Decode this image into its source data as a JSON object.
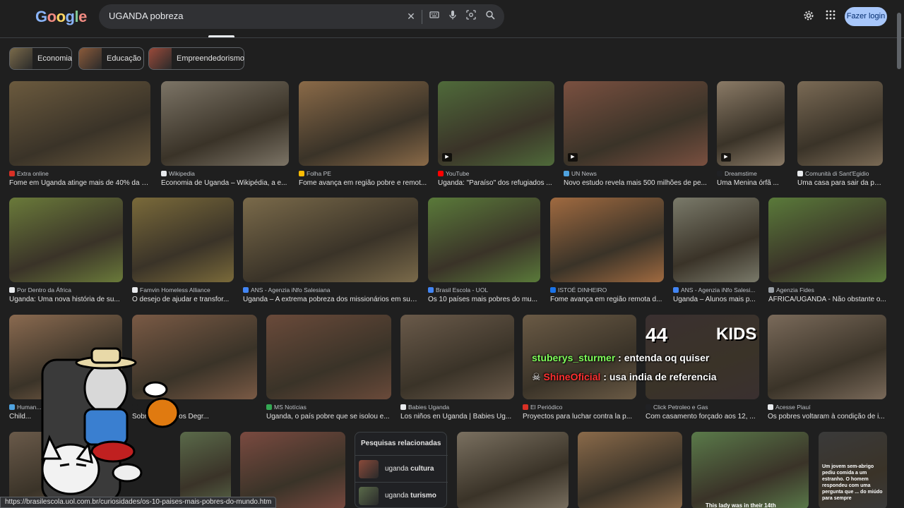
{
  "header": {
    "logo": [
      "G",
      "o",
      "o",
      "g",
      "l",
      "e"
    ],
    "logo_colors": [
      "#8ab4f8",
      "#f28b82",
      "#fdd663",
      "#8ab4f8",
      "#81c995",
      "#f28b82"
    ],
    "search_query": "UGANDA pobreza",
    "login_label": "Fazer login",
    "icons": [
      "clear-icon",
      "keyboard-icon",
      "mic-icon",
      "lens-icon",
      "search-icon",
      "settings-icon",
      "apps-icon"
    ]
  },
  "chips": [
    {
      "label": "Economia",
      "color": "#7a6a4a"
    },
    {
      "label": "Educação",
      "color": "#8a5a3a"
    },
    {
      "label": "Empreendedorismo",
      "color": "#9a4a3a"
    }
  ],
  "row1": [
    {
      "source": "Extra online",
      "caption": "Fome em Uganda atinge mais de 40% da p...",
      "fav": "#d93025",
      "color": "#6b5a3e"
    },
    {
      "source": "Wikipedia",
      "caption": "Economia de Uganda – Wikipédia, a e...",
      "fav": "#e8eaed",
      "color": "#7c7466"
    },
    {
      "source": "Folha PE",
      "caption": "Fome avança em região pobre e remot...",
      "fav": "#fbbc04",
      "color": "#8a6a48"
    },
    {
      "source": "YouTube",
      "caption": "Uganda: \"Paraíso\" dos refugiados ...",
      "fav": "#ff0000",
      "color": "#4f6a3a",
      "video": true
    },
    {
      "source": "UN News",
      "caption": "Novo estudo revela mais 500 milhões de pe...",
      "fav": "#4fa3e0",
      "color": "#7a5040",
      "video": true
    },
    {
      "source": "Dreamstime",
      "caption": "Uma Menina órfã ...",
      "fav": "#202124",
      "color": "#8a7a66",
      "video": true
    },
    {
      "source": "Comunità di Sant'Egidio",
      "caption": "Uma casa para sair da pob...",
      "fav": "#e8eaed",
      "color": "#7a6a55"
    }
  ],
  "row2": [
    {
      "source": "Por Dentro da África",
      "caption": "Uganda: Uma nova história de su...",
      "fav": "#e8eaed",
      "color": "#6a7a3a"
    },
    {
      "source": "Famvin Homeless Alliance",
      "caption": "O desejo de ajudar e transfor...",
      "fav": "#e8eaed",
      "color": "#7a6a3a"
    },
    {
      "source": "ANS - Agenzia iNfo Salesiana",
      "caption": "Uganda – A extrema pobreza dos missionários em sua...",
      "fav": "#4285f4",
      "color": "#7a6a4a"
    },
    {
      "source": "Brasil Escola - UOL",
      "caption": "Os 10 países mais pobres do mu...",
      "fav": "#4285f4",
      "color": "#5a7a3a"
    },
    {
      "source": "ISTOÉ DINHEIRO",
      "caption": "Fome avança em região remota d...",
      "fav": "#1a73e8",
      "color": "#a06a40"
    },
    {
      "source": "ANS - Agenzia iNfo Salesi...",
      "caption": "Uganda – Alunos mais p...",
      "fav": "#4285f4",
      "color": "#7a7a6a"
    },
    {
      "source": "Agenzia Fides",
      "caption": "ÁFRICA/UGANDA - Não obstante o...",
      "fav": "#9aa0a6",
      "color": "#5a7a3a"
    }
  ],
  "row3": [
    {
      "source": "Human...",
      "caption": "Child...",
      "fav": "#4fa3e0",
      "color": "#8a6a50"
    },
    {
      "source": "",
      "caption": "Sobre Os Bairros Degr...",
      "fav": "#1f1f1f",
      "color": "#7a5a45"
    },
    {
      "source": "MS Notícias",
      "caption": "Uganda, o país pobre que se isolou e...",
      "fav": "#34a853",
      "color": "#6a4a3a"
    },
    {
      "source": "Babies Uganda",
      "caption": "Los niños en Uganda | Babies Ug...",
      "fav": "#e8eaed",
      "color": "#6a5a4a"
    },
    {
      "source": "El Periódico",
      "caption": "Proyectos para luchar contra la p...",
      "fav": "#d93025",
      "color": "#6a5a45"
    },
    {
      "source": "Click Petroleo e Gas",
      "caption": "Com casamento forçado aos 12, ...",
      "fav": "#202124",
      "color": "#3a3030"
    },
    {
      "source": "Acesse Piauí",
      "caption": "Os pobres voltaram à condição de i...",
      "fav": "#e8eaed",
      "color": "#7a6a5a"
    }
  ],
  "row4_colors": [
    "#6a5a4a",
    "#5a6a4a",
    "#7a4a40",
    "#7a7060",
    "#8a6a4a",
    "#5a7a4a",
    "#3a3a3a"
  ],
  "row4_overlay_text": "Um jovem sem-abrigo pediu comida a um estranho. O homem respondeu com uma pergunta que ... do miúdo para sempre",
  "row4_bottom_text": "This lady was in their 14th",
  "related": {
    "title": "Pesquisas relacionadas",
    "items": [
      {
        "prefix": "uganda ",
        "term": "cultura",
        "color": "#8a4a3a"
      },
      {
        "prefix": "uganda ",
        "term": "turismo",
        "color": "#5a6a4a"
      }
    ]
  },
  "overlay": {
    "thumb_number": "44",
    "thumb_word": "KIDS",
    "chat": [
      {
        "user": "stuberys_sturmer",
        "sep": " : ",
        "message": "entenda oq quiser",
        "user_color": "#7fff5a"
      },
      {
        "user": "ShineOficial",
        "sep": " : ",
        "message": "usa india de referencia",
        "user_color": "#ff3030"
      }
    ]
  },
  "status_url": "https://brasilescola.uol.com.br/curiosidades/os-10-paises-mais-pobres-do-mundo.htm"
}
